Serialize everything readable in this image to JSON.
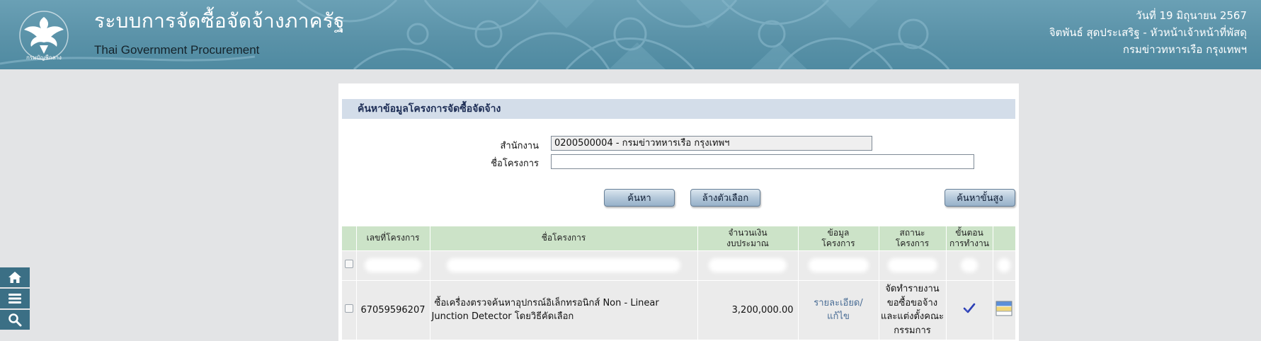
{
  "header": {
    "app_title": "ระบบการจัดซื้อจัดจ้างภาครัฐ",
    "app_subtitle": "Thai Government Procurement",
    "logo_icon": "comptroller-general-garuda-logo",
    "date": "วันที่ 19 มิถุนายน 2567",
    "user": "จิตพันธ์ สุดประเสริฐ - หัวหน้าเจ้าหน้าที่พัสดุ",
    "department": "กรมข่าวทหารเรือ กรุงเทพฯ",
    "colors": {
      "banner": "#5a92a8",
      "title_text": "#ffffff"
    }
  },
  "quick_nav": [
    {
      "icon": "home-icon"
    },
    {
      "icon": "menu-icon"
    },
    {
      "icon": "search-icon"
    }
  ],
  "search": {
    "title": "ค้นหาข้อมูลโครงการจัดซื้อจัดจ้าง",
    "office_label": "สำนักงาน",
    "office_value": "0200500004 - กรมข่าวทหารเรือ กรุงเทพฯ",
    "project_name_label": "ชื่อโครงการ",
    "project_name_value": "",
    "search_button": "ค้นหา",
    "clear_button": "ล้างตัวเลือก",
    "advanced_button": "ค้นหาขั้นสูง"
  },
  "table": {
    "headers": {
      "project_no": "เลขที่โครงการ",
      "project_name": "ชื่อโครงการ",
      "budget_1": "จำนวนเงิน",
      "budget_2": "งบประมาณ",
      "info_1": "ข้อมูล",
      "info_2": "โครงการ",
      "status_1": "สถานะ",
      "status_2": "โครงการ",
      "step_1": "ขั้นตอน",
      "step_2": "การทำงาน"
    },
    "rows": [
      {
        "project_no": "67059596207",
        "project_name_1": "ซื้อเครื่องตรวจค้นหาอุปกรณ์อิเล็กทรอนิกส์ Non - Linear",
        "project_name_2": "Junction Detector โดยวิธีคัดเลือก",
        "budget": "3,200,000.00",
        "info_link_1": "รายละเอียด/",
        "info_link_2": "แก้ไข",
        "status_1": "จัดทำรายงาน",
        "status_2": "ขอซื้อขอจ้าง",
        "status_3": "และแต่งตั้งคณะ",
        "status_4": "กรรมการ",
        "step_icon": "checkmark-icon",
        "action_icon": "document-window-icon"
      }
    ]
  }
}
